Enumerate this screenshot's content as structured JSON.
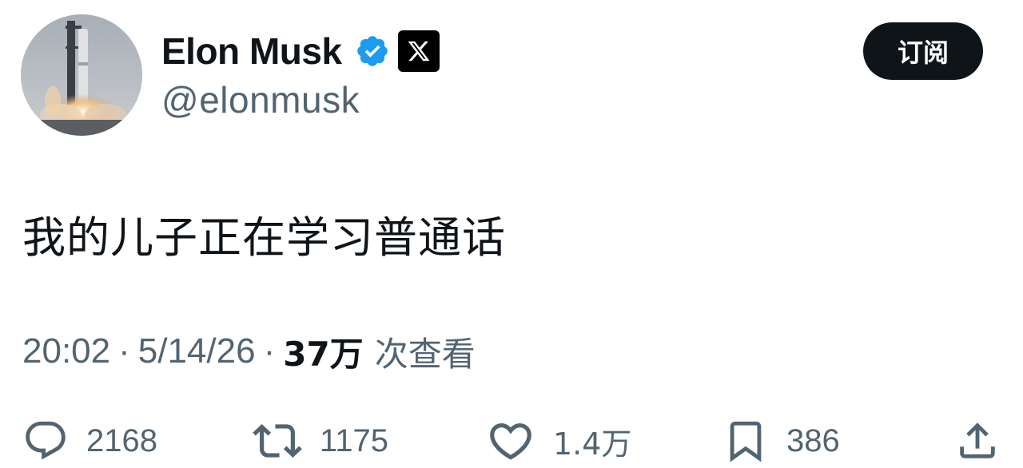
{
  "author": {
    "display_name": "Elon Musk",
    "handle": "@elonmusk",
    "verified": true,
    "avatar": "rocket-launch-avatar"
  },
  "header": {
    "subscribe_label": "订阅"
  },
  "tweet": {
    "text": "我的儿子正在学习普通话",
    "time": "20:02",
    "date": "5/14/26",
    "separator": "·",
    "views_count": "37万",
    "views_label": "次查看"
  },
  "actions": {
    "replies": "2168",
    "reposts": "1175",
    "likes": "1.4万",
    "bookmarks": "386"
  },
  "icons": {
    "verified": "verified-badge-icon",
    "x_logo": "x-logo-icon",
    "reply": "reply-icon",
    "repost": "repost-icon",
    "like": "heart-icon",
    "bookmark": "bookmark-icon",
    "share": "share-icon"
  },
  "colors": {
    "text_primary": "#0f1419",
    "text_secondary": "#536471",
    "verified_blue": "#1d9bf0",
    "button_bg": "#0f1419",
    "background": "#ffffff"
  }
}
